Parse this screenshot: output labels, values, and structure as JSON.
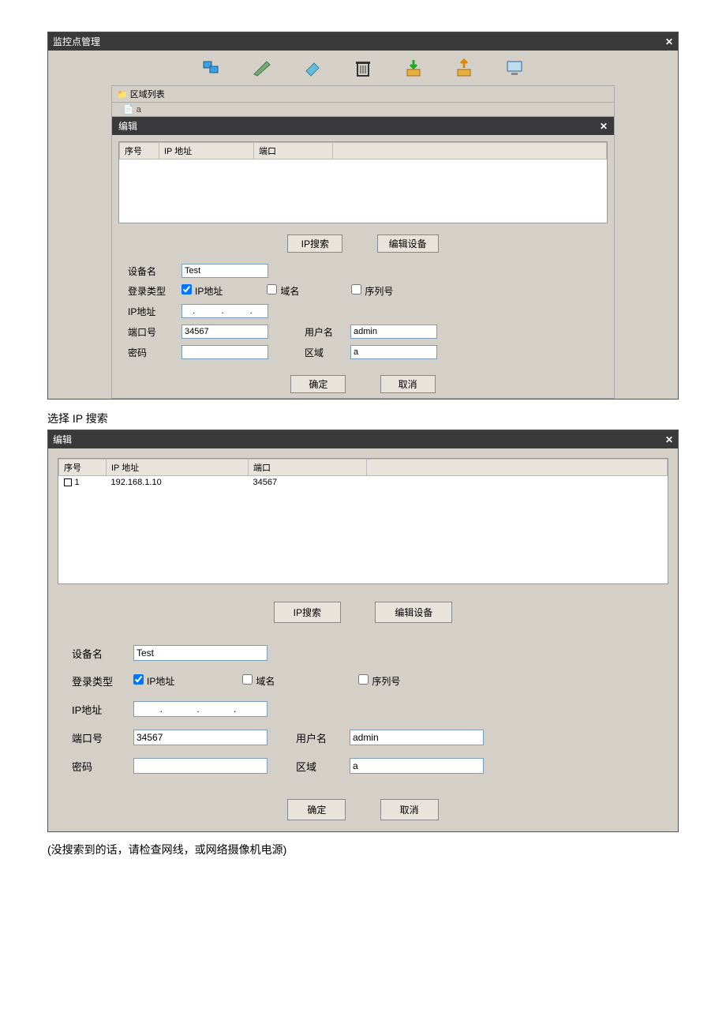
{
  "win1": {
    "title": "监控点管理",
    "treeRoot": "区域列表",
    "editTitle": "编辑",
    "cols": {
      "seq": "序号",
      "ip": "IP 地址",
      "port": "端口"
    },
    "btnSearch": "IP搜索",
    "btnEditDev": "编辑设备",
    "labels": {
      "devName": "设备名",
      "loginType": "登录类型",
      "ipAddr": "IP地址",
      "chkIp": "IP地址",
      "chkDomain": "域名",
      "chkSerial": "序列号",
      "port": "端口号",
      "user": "用户名",
      "pwd": "密码",
      "region": "区域"
    },
    "values": {
      "devName": "Test",
      "ip": ".   .   .",
      "port": "34567",
      "user": "admin",
      "region": "a"
    },
    "ok": "确定",
    "cancel": "取消"
  },
  "caption1": "选择 IP 搜索",
  "win2": {
    "title": "编辑",
    "cols": {
      "seq": "序号",
      "ip": "IP 地址",
      "port": "端口"
    },
    "row": {
      "seq": "1",
      "ip": "192.168.1.10",
      "port": "34567"
    },
    "btnSearch": "IP搜索",
    "btnEditDev": "编辑设备",
    "labels": {
      "devName": "设备名",
      "loginType": "登录类型",
      "ipAddr": "IP地址",
      "chkIp": "IP地址",
      "chkDomain": "域名",
      "chkSerial": "序列号",
      "port": "端口号",
      "user": "用户名",
      "pwd": "密码",
      "region": "区域"
    },
    "values": {
      "devName": "Test",
      "ip": ".    .    .",
      "port": "34567",
      "user": "admin",
      "region": "a"
    },
    "ok": "确定",
    "cancel": "取消"
  },
  "caption2": "(没搜索到的话，请检查网线，或网络摄像机电源)"
}
